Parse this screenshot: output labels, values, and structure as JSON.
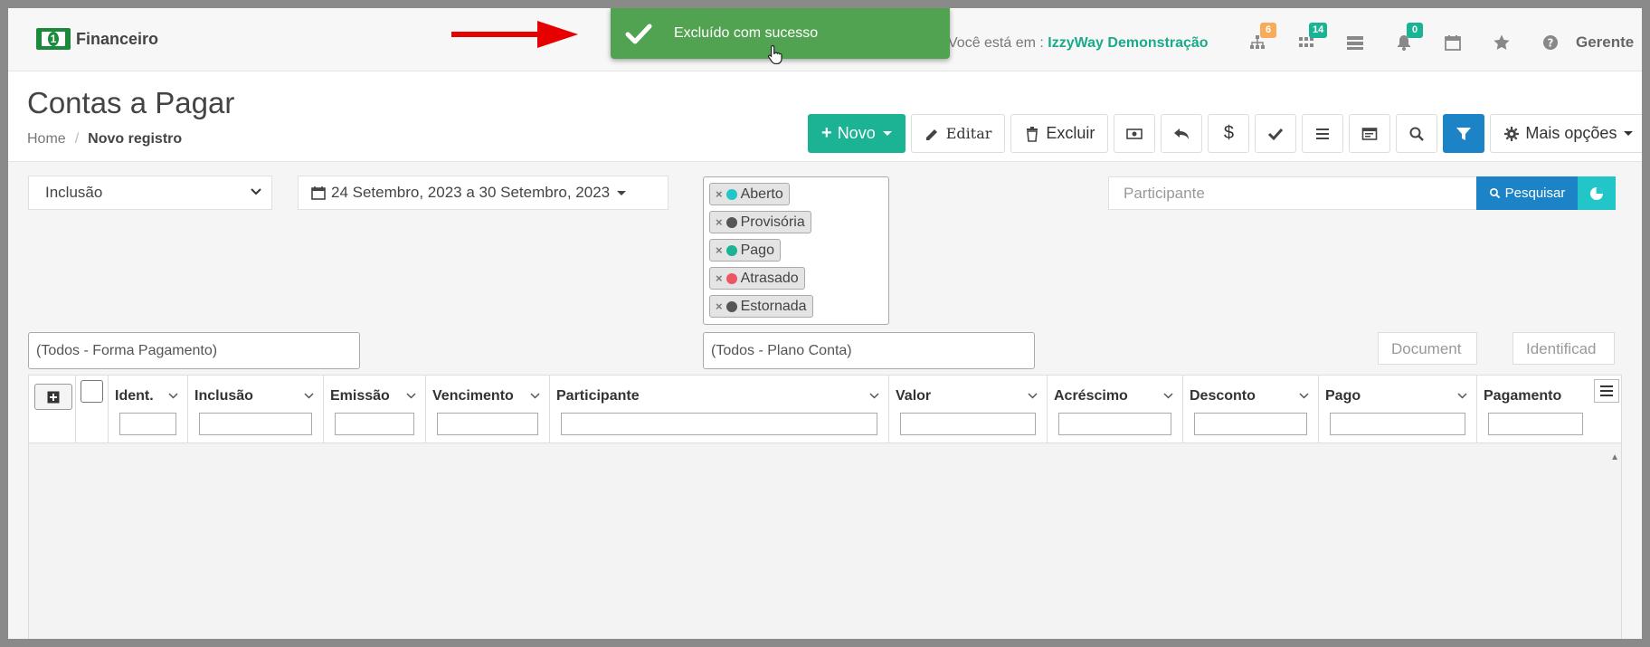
{
  "topbar": {
    "brand": "Financeiro",
    "location_prefix": "Você está em :",
    "location_company": "IzzyWay Demonstração",
    "user": "Gerente",
    "icons": [
      {
        "name": "sitemap-icon",
        "badge": "6",
        "badge_color": "#f8ac59"
      },
      {
        "name": "grid-icon",
        "badge": "14",
        "badge_color": "#1ab394"
      },
      {
        "name": "server-icon",
        "badge": "",
        "badge_color": ""
      },
      {
        "name": "bell-icon",
        "badge": "0",
        "badge_color": "#1ab394"
      },
      {
        "name": "calendar-icon",
        "badge": "",
        "badge_color": ""
      },
      {
        "name": "star-icon",
        "badge": "",
        "badge_color": ""
      },
      {
        "name": "help-icon",
        "badge": "",
        "badge_color": ""
      }
    ]
  },
  "toast": {
    "message": "Excluído com sucesso"
  },
  "header": {
    "title": "Contas a Pagar",
    "breadcrumb": [
      "Home",
      "Novo registro"
    ]
  },
  "toolbar": {
    "novo": "Novo",
    "editar": "Editar",
    "excluir": "Excluir",
    "mais": "Mais opções"
  },
  "filters": {
    "date_type": "Inclusão",
    "date_range": "24 Setembro, 2023 a 30 Setembro, 2023",
    "status_tags": [
      {
        "label": "Aberto",
        "color": "#23c6c8"
      },
      {
        "label": "Provisória",
        "color": "#555555"
      },
      {
        "label": "Pago",
        "color": "#1ab394"
      },
      {
        "label": "Atrasado",
        "color": "#ed5565"
      },
      {
        "label": "Estornada",
        "color": "#555555"
      }
    ],
    "participante_placeholder": "Participante",
    "search_label": "Pesquisar",
    "forma_pagamento": "(Todos - Forma Pagamento)",
    "plano_conta": "(Todos - Plano Conta)",
    "col_document": "Document",
    "col_identificad": "Identificad"
  },
  "grid": {
    "columns": [
      "Ident.",
      "Inclusão",
      "Emissão",
      "Vencimento",
      "Participante",
      "Valor",
      "Acréscimo",
      "Desconto",
      "Pago",
      "Pagamento"
    ]
  },
  "colors": {
    "primary": "#1bb394",
    "info": "#1c84c6",
    "toast": "#51a351"
  }
}
